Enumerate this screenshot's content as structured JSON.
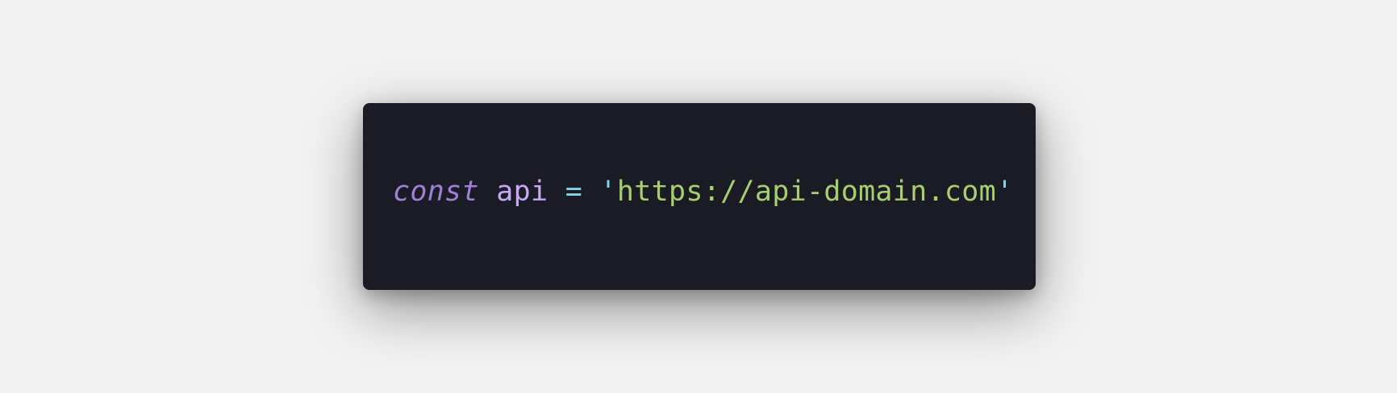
{
  "code": {
    "keyword": "const",
    "identifier": "api",
    "operator": "=",
    "quote_open": "'",
    "string_value": "https://api-domain.com",
    "quote_close": "'"
  },
  "colors": {
    "page_background": "#f2f2f2",
    "card_background": "#1b1b26",
    "keyword": "#a07fd6",
    "identifier": "#c6a8f4",
    "operator": "#7fd3ec",
    "string": "#a7cf6d"
  }
}
